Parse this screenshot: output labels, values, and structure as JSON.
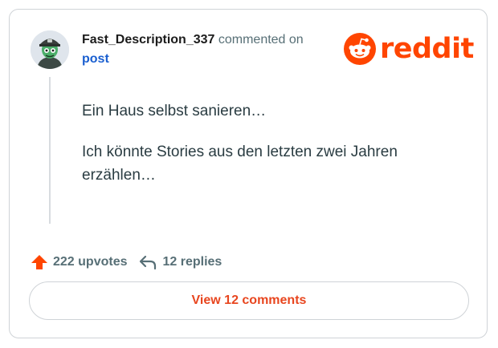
{
  "comment": {
    "username": "Fast_Description_337",
    "action_text": "commented on",
    "post_link": "post",
    "paragraphs": [
      "Ein Haus selbst sanieren…",
      "Ich könnte Stories aus den letzten zwei Jahren erzählen…"
    ]
  },
  "brand": {
    "logo_text": "reddit",
    "logo_icon": "reddit-alien-icon",
    "accent_color": "#ff4500"
  },
  "stats": {
    "upvotes_label": "222 upvotes",
    "upvote_icon": "upvote-arrow-icon",
    "upvote_color": "#ff4500",
    "replies_label": "12 replies",
    "reply_icon": "reply-arrow-icon"
  },
  "footer": {
    "view_comments_label": "View 12 comments"
  }
}
